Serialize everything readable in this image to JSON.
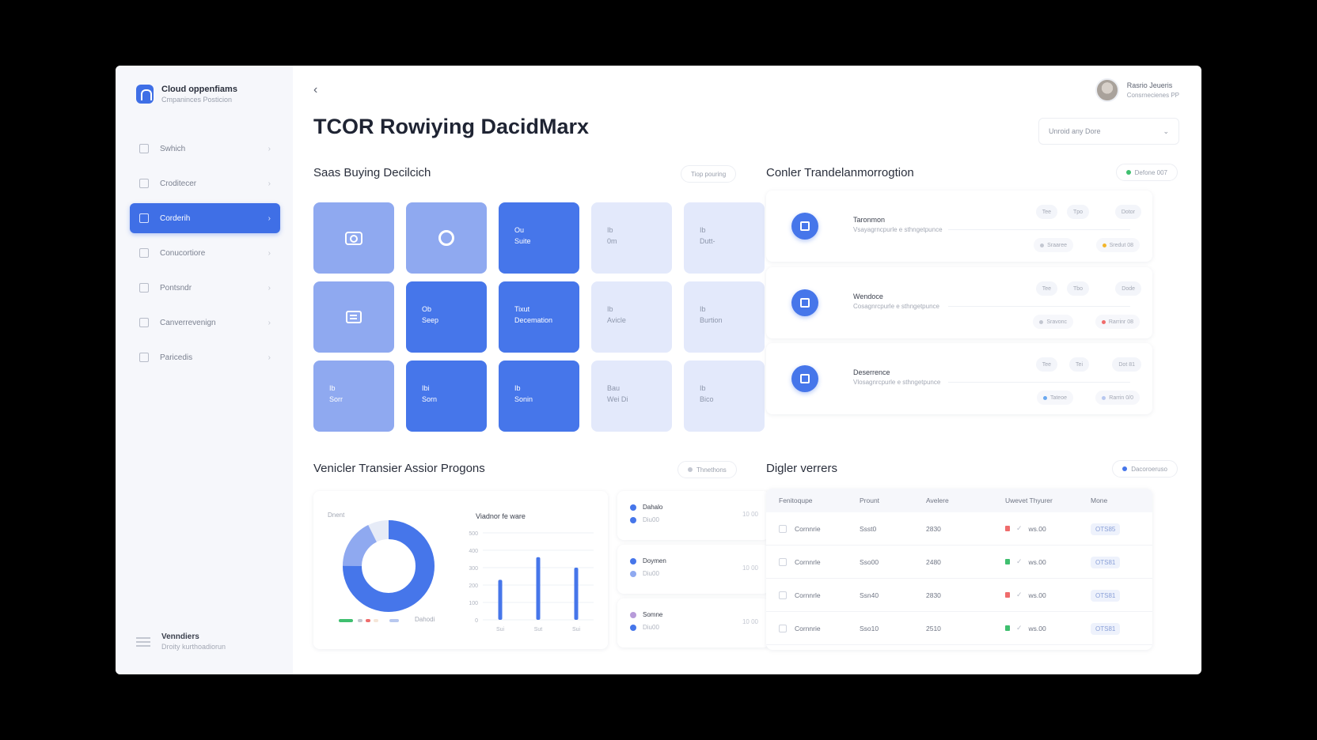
{
  "brand": {
    "title": "Cloud oppenfiams",
    "subtitle": "Cmpaninces Posticion"
  },
  "sidebar": {
    "items": [
      {
        "label": "Swhich",
        "active": false
      },
      {
        "label": "Croditecer",
        "active": false
      },
      {
        "label": "Corderih",
        "active": true
      },
      {
        "label": "Conucortiore",
        "active": false
      },
      {
        "label": "Pontsndr",
        "active": false
      },
      {
        "label": "Canverrevenign",
        "active": false
      },
      {
        "label": "Paricedis",
        "active": false
      }
    ],
    "footer": {
      "title": "Venndiers",
      "subtitle": "Droity kurthoadiorun"
    }
  },
  "header": {
    "title": "TCOR Rowiying DacidMarx",
    "profile_name": "Rasrio Jeueris",
    "profile_sub": "Consrnecienes PP",
    "select_value": "Unroid any Dore"
  },
  "buying": {
    "title": "Saas Buying Decilcich",
    "pill": "Tiop pouring",
    "tiles": [
      {
        "style": "t-mid",
        "icon": "camera-icon",
        "line1": "",
        "line2": ""
      },
      {
        "style": "t-mid",
        "icon": "ring-icon",
        "line1": "",
        "line2": ""
      },
      {
        "style": "t-dark",
        "icon": "",
        "line1": "Ou",
        "line2": "Suite"
      },
      {
        "style": "t-light",
        "icon": "",
        "line1": "Ib",
        "line2": "0m"
      },
      {
        "style": "t-light",
        "icon": "",
        "line1": "Ib",
        "line2": "Dutt-"
      },
      {
        "style": "t-mid",
        "icon": "chat-icon",
        "line1": "",
        "line2": ""
      },
      {
        "style": "t-dark",
        "icon": "",
        "line1": "Ob",
        "line2": "Seep"
      },
      {
        "style": "t-dark",
        "icon": "",
        "line1": "Tixut",
        "line2": "Decemation"
      },
      {
        "style": "t-light",
        "icon": "",
        "line1": "Ib",
        "line2": "Avicle"
      },
      {
        "style": "t-light",
        "icon": "",
        "line1": "Ib",
        "line2": "Burtion"
      },
      {
        "style": "t-mid",
        "icon": "",
        "line1": "Ib",
        "line2": "Sorr"
      },
      {
        "style": "t-dark",
        "icon": "",
        "line1": "Ibi",
        "line2": "Sorn"
      },
      {
        "style": "t-dark",
        "icon": "",
        "line1": "Ib",
        "line2": "Sonin"
      },
      {
        "style": "t-light",
        "icon": "",
        "line1": "Bau",
        "line2": "Wei Di"
      },
      {
        "style": "t-light",
        "icon": "",
        "line1": "Ib",
        "line2": "Bico"
      }
    ]
  },
  "transform": {
    "title": "Conler Trandelanmorrogtion",
    "pill": "Defone 007",
    "pill_color": "#3fbf6f",
    "cards": [
      {
        "title": "Taronmon",
        "desc": "Vsayagrncpurle e sthngetpunce",
        "tags": [
          "Tee",
          "Tpo",
          "Dotor"
        ],
        "stat1": "Sraaree",
        "stat1_color": "#c3c7d1",
        "stat2": "Sredut 08",
        "stat2_color": "#f2b52b"
      },
      {
        "title": "Wendoce",
        "desc": "Cosagnrcpurle e sthngetpunce",
        "tags": [
          "Tee",
          "Tbo",
          "Dode"
        ],
        "stat1": "Sravonc",
        "stat1_color": "#c3c7d1",
        "stat2": "Rarrinr 08",
        "stat2_color": "#ef6c6c"
      },
      {
        "title": "Deserrence",
        "desc": "Vlosagnrcpurle e sthngetpunce",
        "tags": [
          "Tee",
          "Tei",
          "Dot 81"
        ],
        "stat1": "Tateoe",
        "stat1_color": "#6aa8ef",
        "stat2": "Rarrin 0/0",
        "stat2_color": "#b8c8ef"
      }
    ]
  },
  "transfer": {
    "title": "Venicler Transier Assior Progons",
    "pill": "Thnethons",
    "donut_label": "Dnent",
    "bar_title": "Viadnor fe ware",
    "legend_caption": "Dahodi",
    "legend_items": [
      {
        "name": "Dahalo",
        "value": "Diu00",
        "amount": "10 00",
        "color": "#4676ea",
        "color2": "#4676ea"
      },
      {
        "name": "Doymen",
        "value": "Diu00",
        "amount": "10 00",
        "color": "#4676ea",
        "color2": "#8fa9f0"
      },
      {
        "name": "Somne",
        "value": "Diu00",
        "amount": "10 00",
        "color": "#b79bd9",
        "color2": "#4676ea"
      }
    ]
  },
  "chart_data": {
    "type": "bar",
    "title": "Viadnor fe ware",
    "categories": [
      "Sui",
      "Sut",
      "Sui"
    ],
    "values": [
      230,
      360,
      300
    ],
    "ylim": [
      0,
      500
    ],
    "yticks": [
      "0",
      "100",
      "200",
      "300",
      "400",
      "500"
    ],
    "grid": true,
    "donut": {
      "label": "Dnent",
      "values": [
        75,
        25
      ],
      "colors": [
        "#4676ea",
        "#8fa9f0"
      ]
    }
  },
  "digital": {
    "title": "Digler verrers",
    "pill": "Dacoroeruso",
    "pill_color": "#4676ea",
    "columns": [
      "Fenitoqupe",
      "Prount",
      "Avelere",
      "Uwevet Thyurer",
      "Mone"
    ],
    "rows": [
      {
        "name": "Cornnrie",
        "prount": "Ssst0",
        "avel": "2830",
        "mark_color": "#ef6c6c",
        "status": "ws.00",
        "code": "OTS85"
      },
      {
        "name": "Cornnrle",
        "prount": "Sso00",
        "avel": "2480",
        "mark_color": "#3fbf6f",
        "status": "ws.00",
        "code": "OTS81"
      },
      {
        "name": "Cornnrle",
        "prount": "Ssn40",
        "avel": "2830",
        "mark_color": "#ef6c6c",
        "status": "ws.00",
        "code": "OTS81"
      },
      {
        "name": "Cornnrie",
        "prount": "Sso10",
        "avel": "2510",
        "mark_color": "#3fbf6f",
        "status": "ws.00",
        "code": "OTS81"
      }
    ]
  }
}
